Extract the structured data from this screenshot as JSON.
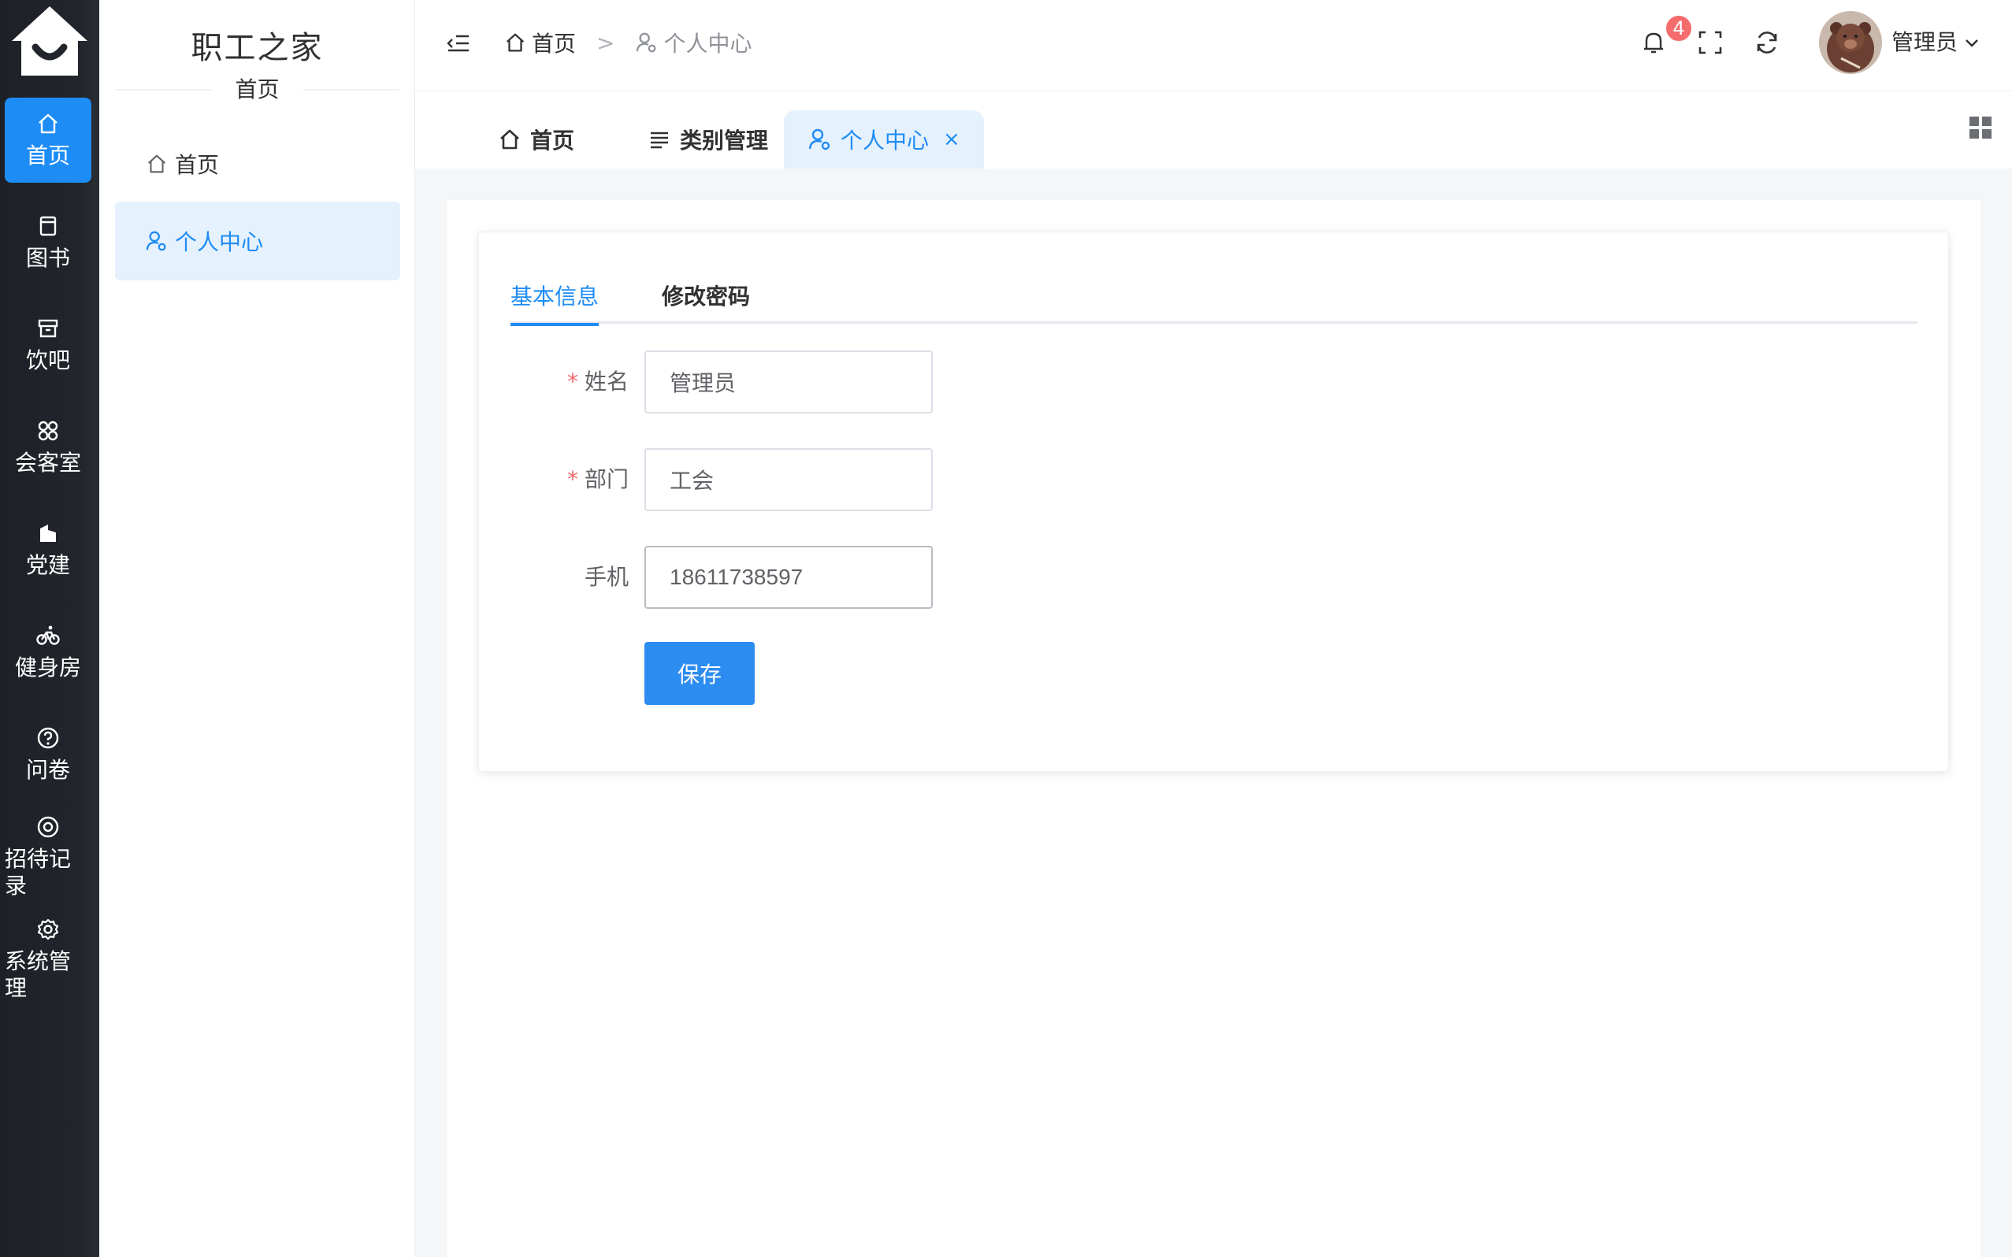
{
  "rail": {
    "items": [
      {
        "label": "首页"
      },
      {
        "label": "图书"
      },
      {
        "label": "饮吧"
      },
      {
        "label": "会客室"
      },
      {
        "label": "党建"
      },
      {
        "label": "健身房"
      },
      {
        "label": "问卷"
      },
      {
        "label": "招待记录"
      },
      {
        "label": "系统管理"
      }
    ]
  },
  "sidebar": {
    "title": "职工之家",
    "subtitle": "首页",
    "items": [
      {
        "label": "首页"
      },
      {
        "label": "个人中心"
      }
    ]
  },
  "header": {
    "breadcrumb": [
      "首页",
      ">",
      "个人中心"
    ],
    "notification_count": "4",
    "user_name": "管理员"
  },
  "tabs": [
    {
      "label": "首页"
    },
    {
      "label": "类别管理"
    },
    {
      "label": "个人中心",
      "close": "×"
    }
  ],
  "profile": {
    "tabs": [
      "基本信息",
      "修改密码"
    ],
    "fields": [
      {
        "label": "姓名",
        "required_mark": "*",
        "value": "管理员"
      },
      {
        "label": "部门",
        "required_mark": "*",
        "value": "工会"
      },
      {
        "label": "手机",
        "value": "18611738597"
      }
    ],
    "save_label": "保存"
  },
  "colors": {
    "primary": "#1e8cf5",
    "rail_bg": "#22262c",
    "active_bg": "#e5f1fd",
    "badge": "#f56c6c"
  }
}
